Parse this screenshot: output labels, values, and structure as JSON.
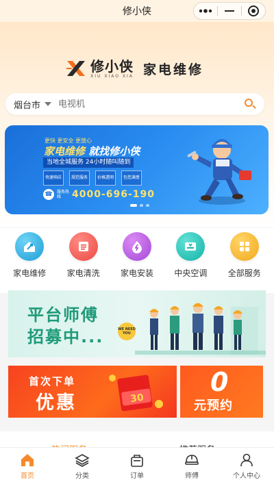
{
  "navbar": {
    "title": "修小侠",
    "more_icon": "more-dots-icon",
    "minimize_icon": "minimize-icon",
    "close_icon": "target-circle-icon"
  },
  "brand": {
    "name": "修小侠",
    "romanized": "XIU XIAO XIA",
    "slogan": "家电维修",
    "colors": {
      "accent": "#f58a2c",
      "orange": "#f36f1e"
    }
  },
  "search": {
    "city": "烟台市",
    "placeholder": "电视机"
  },
  "banner": {
    "tags": "更快  更安全  更放心",
    "headline_a": "家电维修",
    "headline_b": "就找修小侠",
    "subline": "当地全城服务 24小时随叫随到",
    "features": [
      "快速响应",
      "规范服务",
      "价格透明",
      "包您满意"
    ],
    "hotline_label": "服务热线",
    "hotline_number": "4000-696-190",
    "slide_count": 3,
    "active_slide": 0
  },
  "categories": [
    {
      "label": "家电维修",
      "icon": "wrench-house-icon",
      "color": "#2fb6e8"
    },
    {
      "label": "家电清洗",
      "icon": "washing-list-icon",
      "color": "#f4574f"
    },
    {
      "label": "家电安装",
      "icon": "water-drop-icon",
      "color": "#b85ae0"
    },
    {
      "label": "中央空调",
      "icon": "air-conditioner-icon",
      "color": "#22c2b8"
    },
    {
      "label": "全部服务",
      "icon": "grid-apps-icon",
      "color": "#f5b632"
    }
  ],
  "recruit": {
    "line1": "平台师傅",
    "line2": "招募中...",
    "badge": "WE NEED YOU"
  },
  "promo": {
    "left_line1": "首次下单",
    "left_line2": "优惠",
    "coupon_value": "30",
    "right_number": "0",
    "right_text": "元预约"
  },
  "sections": {
    "tab1": "热门服务",
    "tab2": "推荐服务"
  },
  "tabbar": [
    {
      "label": "首页",
      "icon": "home-icon",
      "active": true
    },
    {
      "label": "分类",
      "icon": "layers-icon",
      "active": false
    },
    {
      "label": "订单",
      "icon": "bag-icon",
      "active": false
    },
    {
      "label": "师傅",
      "icon": "helmet-icon",
      "active": false
    },
    {
      "label": "个人中心",
      "icon": "user-icon",
      "active": false
    }
  ]
}
